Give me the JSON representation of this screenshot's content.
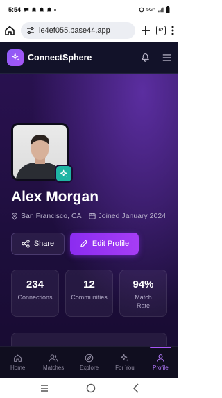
{
  "status_bar": {
    "time": "5:54",
    "network": "5G⁺"
  },
  "browser": {
    "url": "le4ef055.base44.app",
    "tab_count": "62"
  },
  "app": {
    "brand": "ConnectSphere",
    "profile": {
      "name": "Alex Morgan",
      "location": "San Francisco, CA",
      "joined": "Joined January 2024"
    },
    "buttons": {
      "share": "Share",
      "edit": "Edit Profile"
    },
    "stats": [
      {
        "value": "234",
        "label": "Connections"
      },
      {
        "value": "12",
        "label": "Communities"
      },
      {
        "value": "94%",
        "label": "Match Rate"
      }
    ],
    "nav": [
      {
        "label": "Home",
        "icon": "home-icon"
      },
      {
        "label": "Matches",
        "icon": "users-icon"
      },
      {
        "label": "Explore",
        "icon": "compass-icon"
      },
      {
        "label": "For You",
        "icon": "sparkles-icon"
      },
      {
        "label": "Profile",
        "icon": "user-icon",
        "active": true
      }
    ]
  },
  "colors": {
    "accent": "#a855f7",
    "badge": "#1fb5a4",
    "header_bg": "#121229"
  }
}
